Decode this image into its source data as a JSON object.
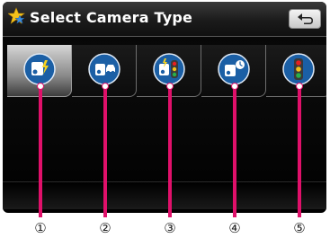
{
  "header": {
    "title": "Select Camera Type",
    "back_icon": "back-arrow-icon"
  },
  "camera_types": [
    {
      "icon": "fixed-speed-camera-icon"
    },
    {
      "icon": "mobile-speed-camera-icon"
    },
    {
      "icon": "red-light-camera-icon"
    },
    {
      "icon": "average-speed-camera-icon"
    },
    {
      "icon": "traffic-light-icon"
    }
  ],
  "selected_index": 0,
  "callouts": [
    "①",
    "②",
    "③",
    "④",
    "⑤"
  ],
  "colors": {
    "accent": "#e0106a",
    "title_text": "#ffffff",
    "screen_bg": "#050505",
    "icon_blue": "#1b5fa5"
  }
}
